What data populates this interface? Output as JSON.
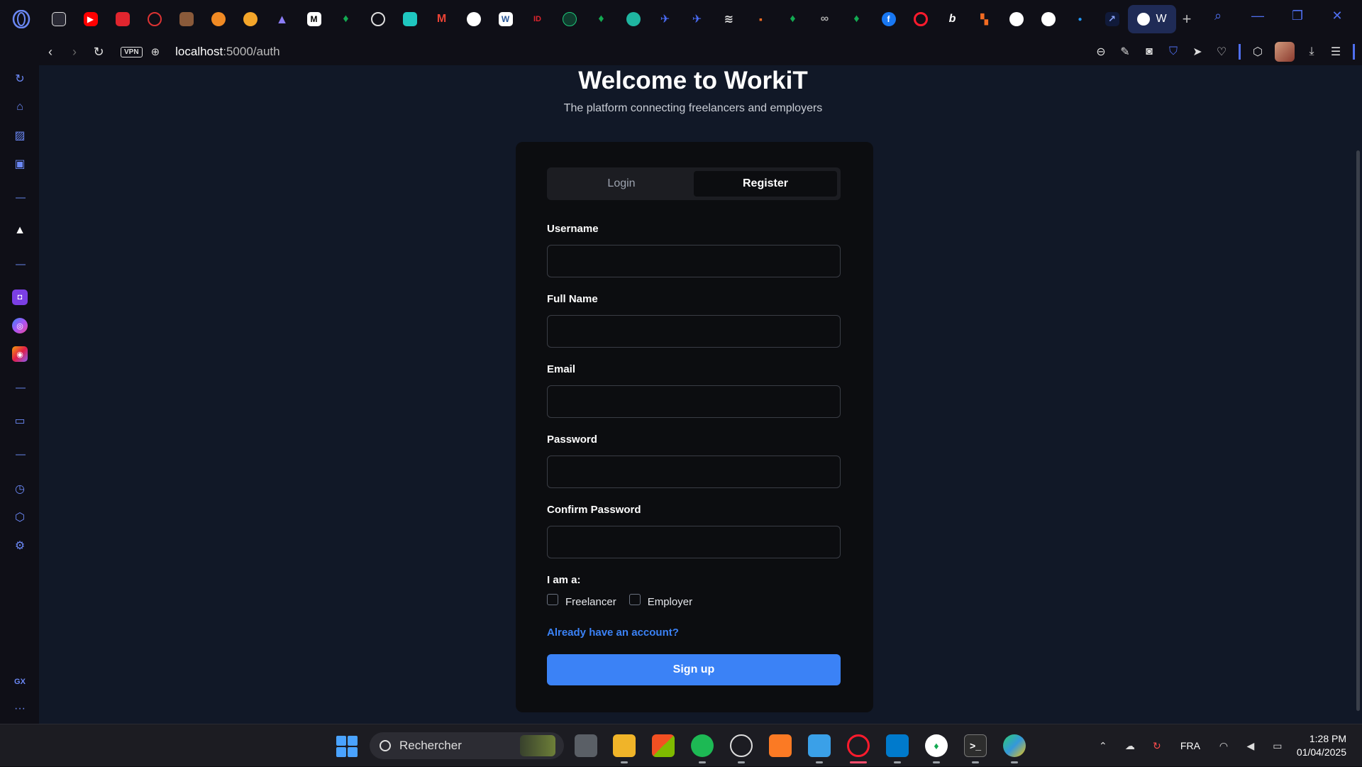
{
  "browser": {
    "active_tab_label": "W",
    "url": "localhost",
    "url_path": ":5000/auth",
    "vpn_label": "VPN",
    "accent": "#4f6ff0"
  },
  "sidebar": {
    "gx_label": "GX",
    "more_label": "···"
  },
  "page": {
    "title": "Welcome to WorkiT",
    "subtitle": "The platform connecting freelancers and employers"
  },
  "auth": {
    "tabs": [
      {
        "label": "Login",
        "active": false
      },
      {
        "label": "Register",
        "active": true
      }
    ],
    "fields": [
      {
        "label": "Username",
        "value": ""
      },
      {
        "label": "Full Name",
        "value": ""
      },
      {
        "label": "Email",
        "value": ""
      },
      {
        "label": "Password",
        "value": ""
      },
      {
        "label": "Confirm Password",
        "value": ""
      }
    ],
    "role_label": "I am a:",
    "roles": [
      {
        "label": "Freelancer",
        "checked": false
      },
      {
        "label": "Employer",
        "checked": false
      }
    ],
    "login_link": "Already have an account?",
    "submit_label": "Sign up",
    "accent": "#3b82f6"
  },
  "taskbar": {
    "search_placeholder": "Rechercher",
    "language": "FRA",
    "time": "1:28 PM",
    "date": "01/04/2025"
  }
}
